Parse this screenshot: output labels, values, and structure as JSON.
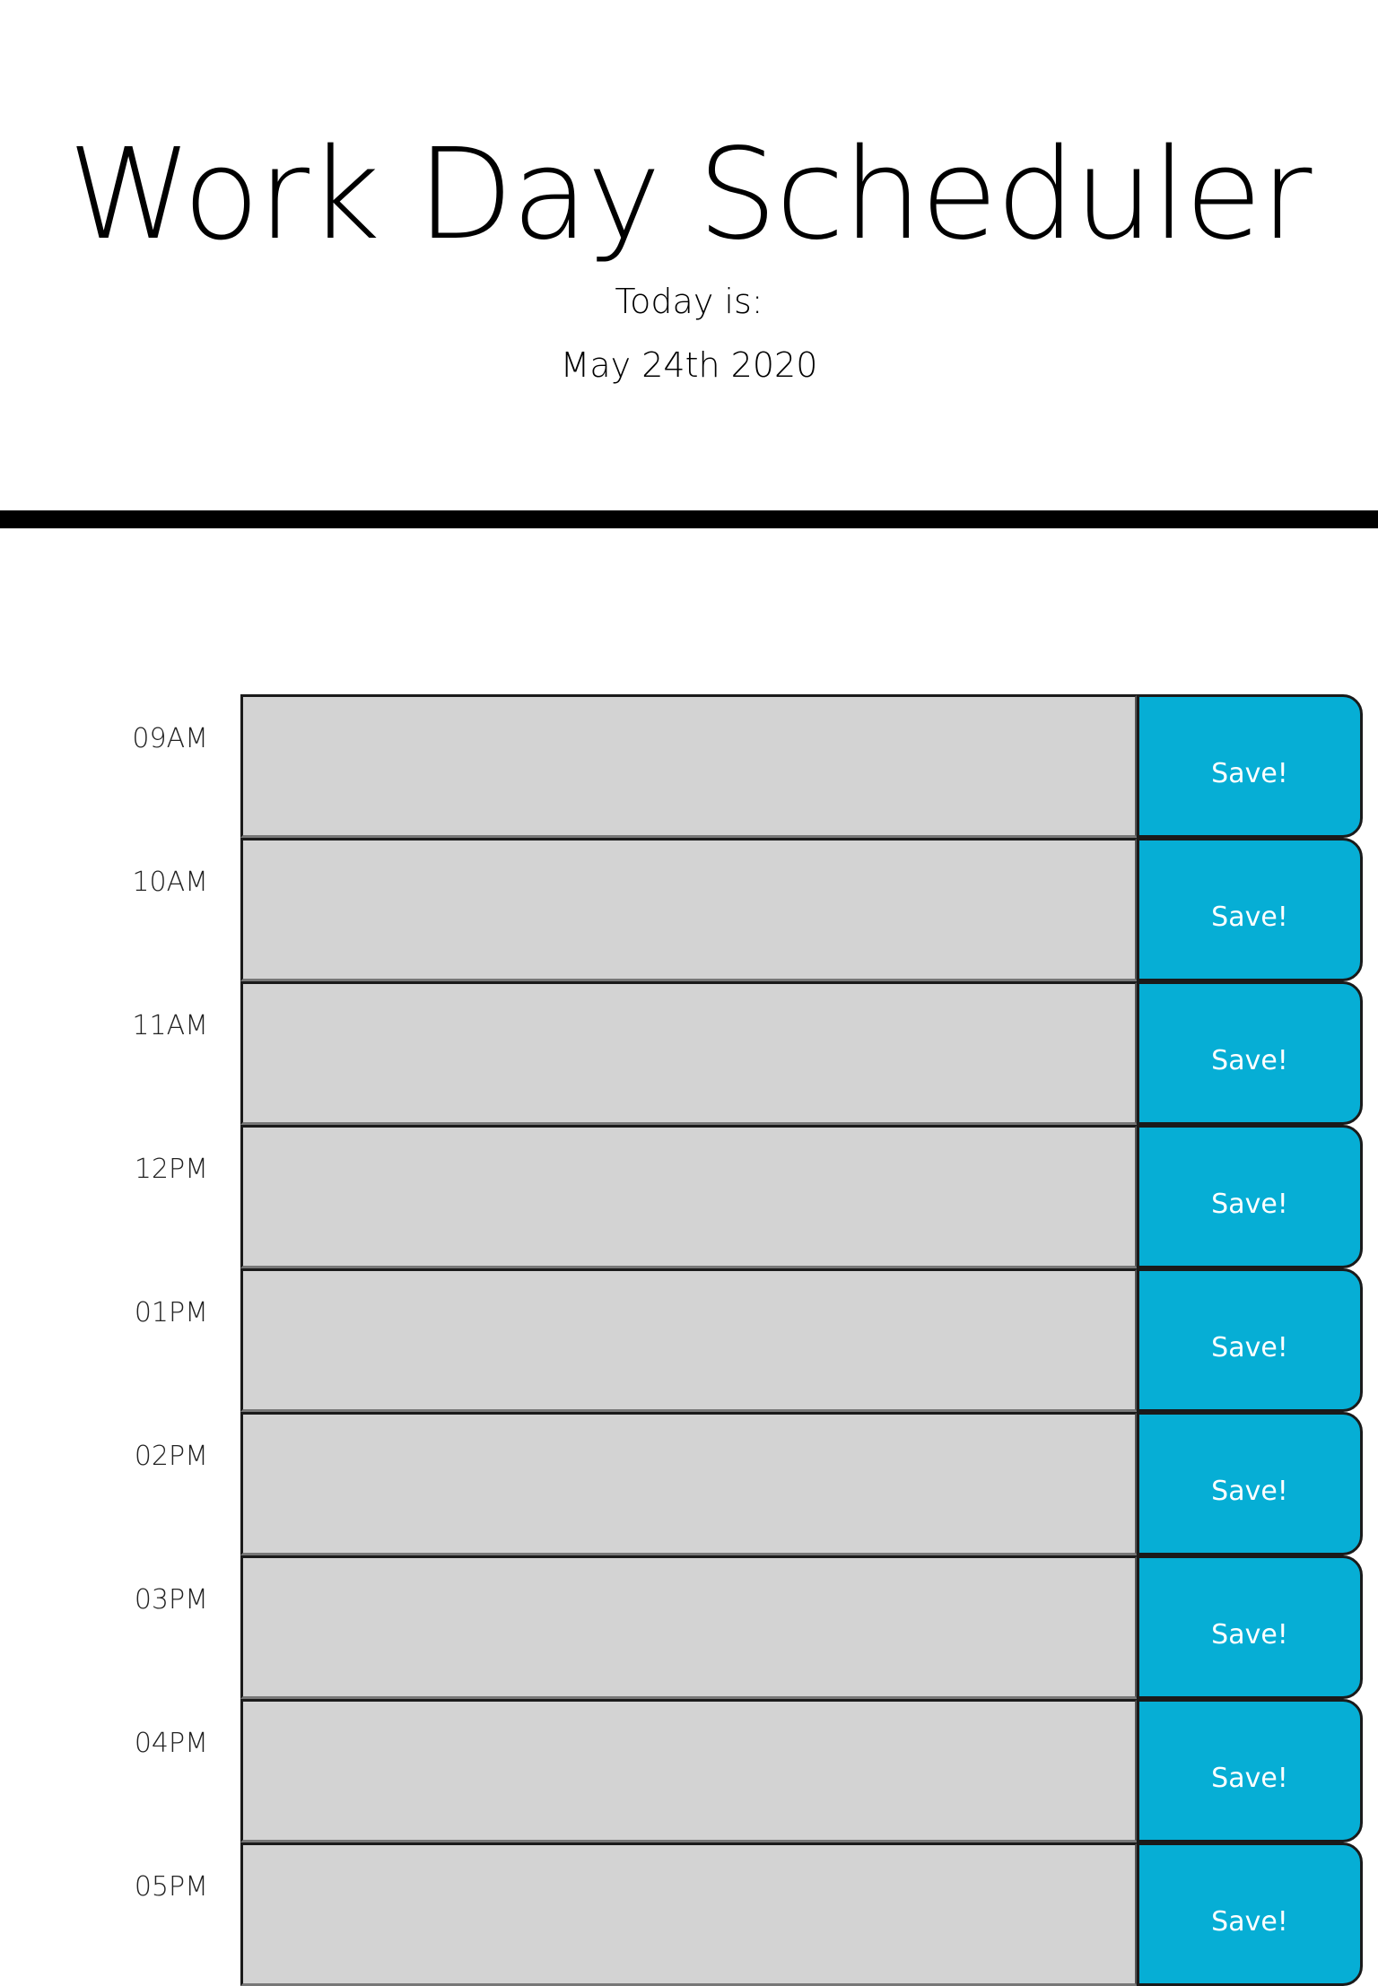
{
  "header": {
    "title": "Work Day Scheduler",
    "today_label": "Today is:",
    "current_day": "May 24th 2020"
  },
  "schedule": {
    "save_label": "Save!",
    "colors": {
      "description_background": "#d3d3d3",
      "save_button": "#06aed5",
      "divider": "#000000"
    },
    "blocks": [
      {
        "hour": "09AM",
        "text": ""
      },
      {
        "hour": "10AM",
        "text": ""
      },
      {
        "hour": "11AM",
        "text": ""
      },
      {
        "hour": "12PM",
        "text": ""
      },
      {
        "hour": "01PM",
        "text": ""
      },
      {
        "hour": "02PM",
        "text": ""
      },
      {
        "hour": "03PM",
        "text": ""
      },
      {
        "hour": "04PM",
        "text": ""
      },
      {
        "hour": "05PM",
        "text": ""
      }
    ]
  }
}
